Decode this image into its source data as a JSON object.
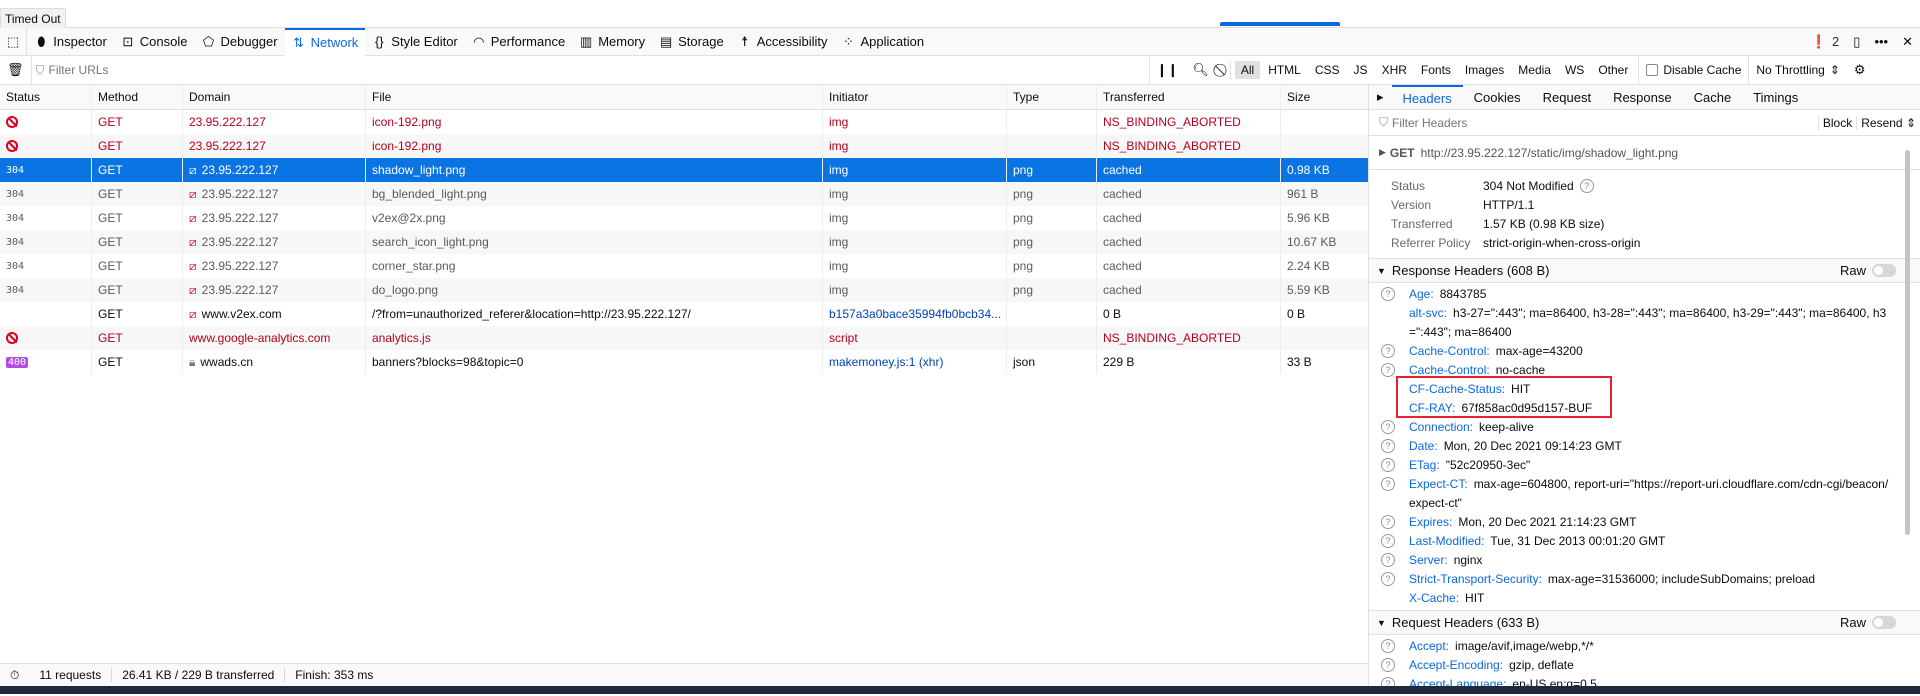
{
  "browser": {
    "tab_title": "Timed Out"
  },
  "toolbar": {
    "tools": [
      {
        "label": "Inspector",
        "icon": "inspector-icon"
      },
      {
        "label": "Console",
        "icon": "console-icon"
      },
      {
        "label": "Debugger",
        "icon": "debugger-icon"
      },
      {
        "label": "Network",
        "icon": "network-icon",
        "selected": true
      },
      {
        "label": "Style Editor",
        "icon": "style-editor-icon"
      },
      {
        "label": "Performance",
        "icon": "performance-icon"
      },
      {
        "label": "Memory",
        "icon": "memory-icon"
      },
      {
        "label": "Storage",
        "icon": "storage-icon"
      },
      {
        "label": "Accessibility",
        "icon": "accessibility-icon"
      },
      {
        "label": "Application",
        "icon": "application-icon"
      }
    ],
    "error_count": "2"
  },
  "filter": {
    "placeholder": "Filter URLs",
    "types": [
      "All",
      "HTML",
      "CSS",
      "JS",
      "XHR",
      "Fonts",
      "Images",
      "Media",
      "WS",
      "Other"
    ],
    "disable_cache": "Disable Cache",
    "throttling": "No Throttling"
  },
  "table": {
    "columns": [
      "Status",
      "Method",
      "Domain",
      "File",
      "Initiator",
      "Type",
      "Transferred",
      "Size"
    ],
    "rows": [
      {
        "status": "blocked",
        "method": "GET",
        "domain": "23.95.222.127",
        "file": "icon-192.png",
        "initiator": "img",
        "type": "",
        "transferred": "NS_BINDING_ABORTED",
        "size": "",
        "error": true
      },
      {
        "status": "blocked",
        "method": "GET",
        "domain": "23.95.222.127",
        "file": "icon-192.png",
        "initiator": "img",
        "type": "",
        "transferred": "NS_BINDING_ABORTED",
        "size": "",
        "error": true
      },
      {
        "status": "304",
        "method": "GET",
        "domain": "23.95.222.127",
        "file": "shadow_light.png",
        "initiator": "img",
        "type": "png",
        "transferred": "cached",
        "size": "0.98 KB",
        "selected": true,
        "insecure": true
      },
      {
        "status": "304",
        "method": "GET",
        "domain": "23.95.222.127",
        "file": "bg_blended_light.png",
        "initiator": "img",
        "type": "png",
        "transferred": "cached",
        "size": "961 B",
        "insecure": true
      },
      {
        "status": "304",
        "method": "GET",
        "domain": "23.95.222.127",
        "file": "v2ex@2x.png",
        "initiator": "img",
        "type": "png",
        "transferred": "cached",
        "size": "5.96 KB",
        "insecure": true
      },
      {
        "status": "304",
        "method": "GET",
        "domain": "23.95.222.127",
        "file": "search_icon_light.png",
        "initiator": "img",
        "type": "png",
        "transferred": "cached",
        "size": "10.67 KB",
        "insecure": true
      },
      {
        "status": "304",
        "method": "GET",
        "domain": "23.95.222.127",
        "file": "corner_star.png",
        "initiator": "img",
        "type": "png",
        "transferred": "cached",
        "size": "2.24 KB",
        "insecure": true
      },
      {
        "status": "304",
        "method": "GET",
        "domain": "23.95.222.127",
        "file": "do_logo.png",
        "initiator": "img",
        "type": "png",
        "transferred": "cached",
        "size": "5.59 KB",
        "insecure": true
      },
      {
        "status": "",
        "method": "GET",
        "domain": "www.v2ex.com",
        "file": "/?from=unauthorized_referer&location=http://23.95.222.127/",
        "initiator": "b157a3a0bace35994fb0bcb34...",
        "type": "",
        "transferred": "0 B",
        "size": "0 B",
        "insecure": true,
        "normal": true
      },
      {
        "status": "blocked",
        "method": "GET",
        "domain": "www.google-analytics.com",
        "file": "analytics.js",
        "initiator": "script",
        "type": "",
        "transferred": "NS_BINDING_ABORTED",
        "size": "",
        "error": true
      },
      {
        "status": "400",
        "method": "GET",
        "domain": "wwads.cn",
        "file": "banners?blocks=98&topic=0",
        "initiator": "makemoney.js:1 (xhr)",
        "type": "json",
        "transferred": "229 B",
        "size": "33 B",
        "secure": true,
        "normal": true
      }
    ]
  },
  "panel": {
    "tabs": [
      "Headers",
      "Cookies",
      "Request",
      "Response",
      "Cache",
      "Timings"
    ],
    "filter_placeholder": "Filter Headers",
    "block": "Block",
    "resend": "Resend",
    "request_method": "GET",
    "request_url": "http://23.95.222.127/static/img/shadow_light.png",
    "summary": [
      {
        "k": "Status",
        "v": "304 Not Modified"
      },
      {
        "k": "Version",
        "v": "HTTP/1.1"
      },
      {
        "k": "Transferred",
        "v": "1.57 KB (0.98 KB size)"
      },
      {
        "k": "Referrer Policy",
        "v": "strict-origin-when-cross-origin"
      }
    ],
    "response_title": "Response Headers (608 B)",
    "raw": "Raw",
    "response_headers": [
      {
        "k": "Age:",
        "v": "8843785",
        "help": true
      },
      {
        "k": "alt-svc:",
        "v": "h3-27=\":443\"; ma=86400, h3-28=\":443\"; ma=86400, h3-29=\":443\"; ma=86400, h3=\":443\"; ma=86400",
        "help": false
      },
      {
        "k": "Cache-Control:",
        "v": "max-age=43200",
        "help": true
      },
      {
        "k": "Cache-Control:",
        "v": "no-cache",
        "help": true
      },
      {
        "k": "CF-Cache-Status:",
        "v": "HIT",
        "help": false
      },
      {
        "k": "CF-RAY:",
        "v": "67f858ac0d95d157-BUF",
        "help": false
      },
      {
        "k": "Connection:",
        "v": "keep-alive",
        "help": true
      },
      {
        "k": "Date:",
        "v": "Mon, 20 Dec 2021 09:14:23 GMT",
        "help": true
      },
      {
        "k": "ETag:",
        "v": "\"52c20950-3ec\"",
        "help": true
      },
      {
        "k": "Expect-CT:",
        "v": "max-age=604800, report-uri=\"https://report-uri.cloudflare.com/cdn-cgi/beacon/expect-ct\"",
        "help": true
      },
      {
        "k": "Expires:",
        "v": "Mon, 20 Dec 2021 21:14:23 GMT",
        "help": true
      },
      {
        "k": "Last-Modified:",
        "v": "Tue, 31 Dec 2013 00:01:20 GMT",
        "help": true
      },
      {
        "k": "Server:",
        "v": "nginx",
        "help": true
      },
      {
        "k": "Strict-Transport-Security:",
        "v": "max-age=31536000; includeSubDomains; preload",
        "help": true
      },
      {
        "k": "X-Cache:",
        "v": "HIT",
        "help": false
      }
    ],
    "request_title": "Request Headers (633 B)",
    "request_headers": [
      {
        "k": "Accept:",
        "v": "image/avif,image/webp,*/*",
        "help": true
      },
      {
        "k": "Accept-Encoding:",
        "v": "gzip, deflate",
        "help": true
      },
      {
        "k": "Accept-Language:",
        "v": "en-US,en;q=0.5",
        "help": true
      }
    ]
  },
  "statusbar": {
    "requests": "11 requests",
    "transferred": "26.41 KB / 229 B transferred",
    "finish": "Finish: 353 ms"
  },
  "colors": {
    "accent": "#0a68e0",
    "selected_row": "#0a74e3",
    "error": "#b3001e",
    "highlight_box": "#e8212f"
  }
}
